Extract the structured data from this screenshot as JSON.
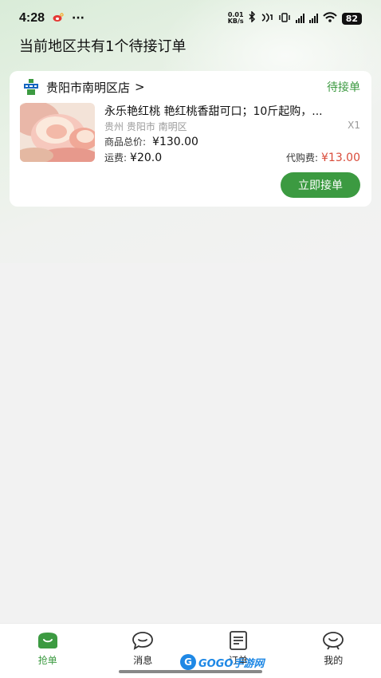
{
  "status_bar": {
    "time": "4:28",
    "more": "···",
    "net_speed_value": "0.01",
    "net_speed_unit": "KB/s",
    "battery": "82"
  },
  "header": {
    "title": "当前地区共有1个待接订单"
  },
  "order": {
    "store_name": "贵阳市南明区店",
    "store_arrow": ">",
    "status": "待接单",
    "product_title": "永乐艳红桃 艳红桃香甜可口；10斤起购，...",
    "region": "贵州 贵阳市 南明区",
    "quantity": "X1",
    "total_label": "商品总价:",
    "total_value": "¥130.00",
    "shipping_label": "运费:",
    "shipping_value": "¥20.0",
    "fee_label": "代购费:",
    "fee_value": "¥13.00",
    "accept_label": "立即接单"
  },
  "tabs": [
    {
      "label": "抢单",
      "icon": "grab-order-icon",
      "active": true
    },
    {
      "label": "消息",
      "icon": "message-icon",
      "active": false
    },
    {
      "label": "订单",
      "icon": "order-icon",
      "active": false
    },
    {
      "label": "我的",
      "icon": "profile-icon",
      "active": false
    }
  ],
  "watermark": {
    "logo": "G",
    "text": "GOGO手游网"
  },
  "colors": {
    "accent": "#3c9a41",
    "fee_red": "#d94b3a",
    "background": "#f2f2f2"
  }
}
